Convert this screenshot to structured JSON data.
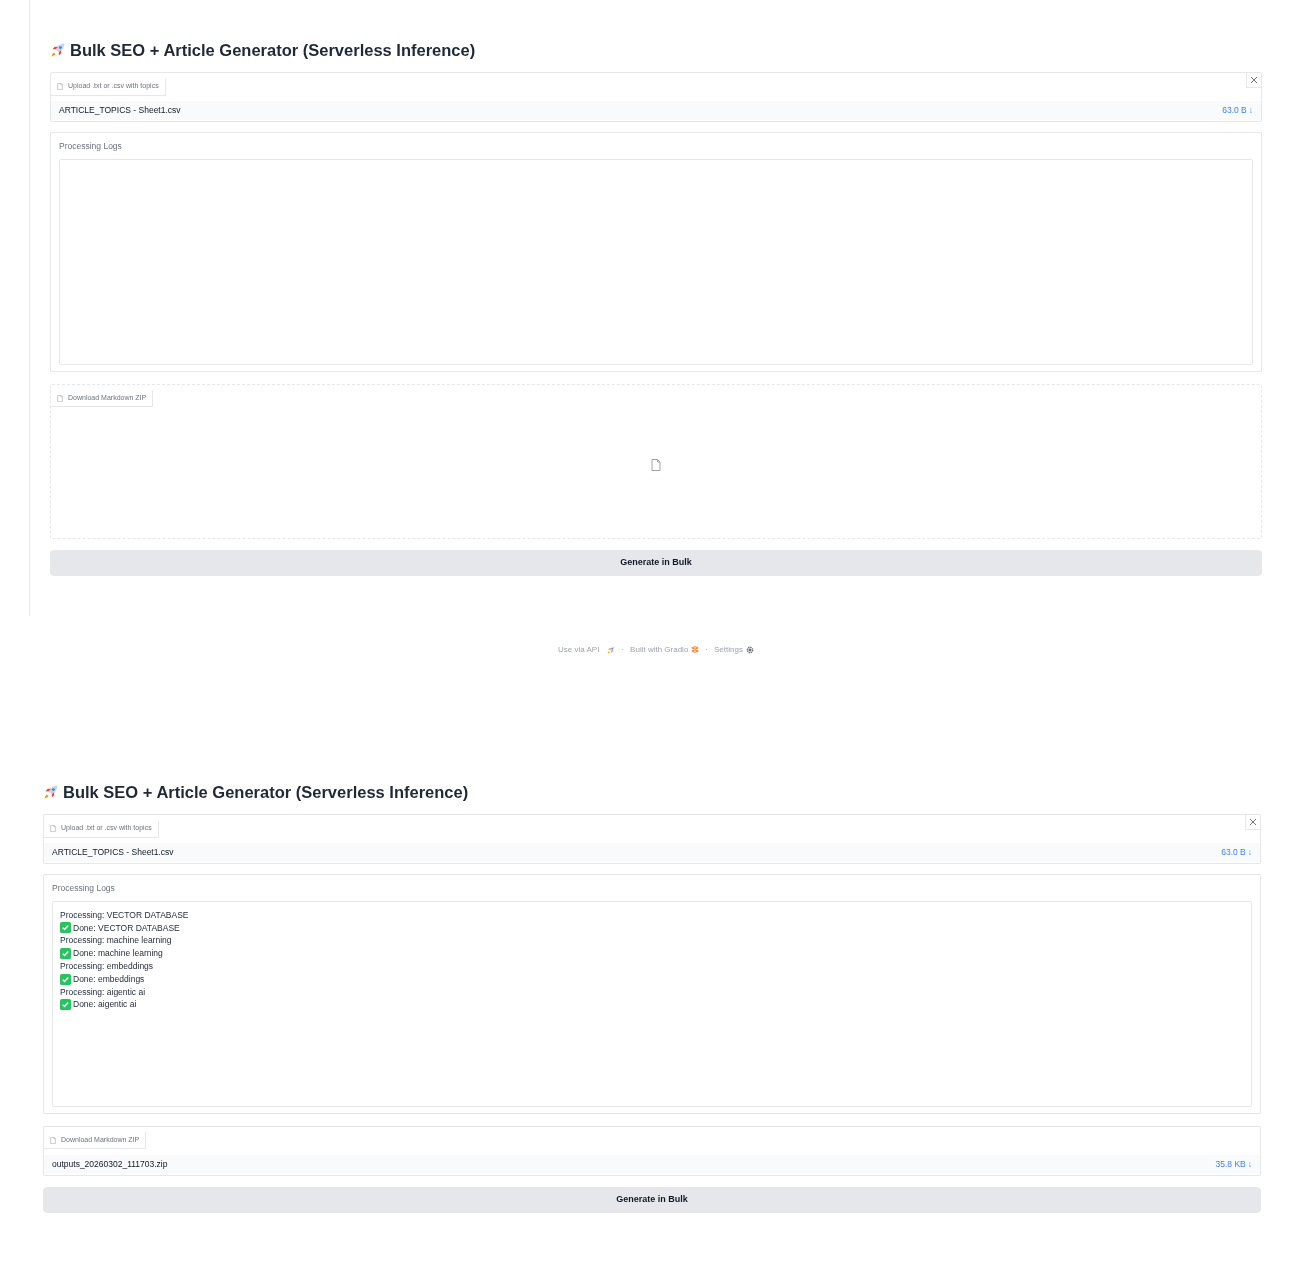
{
  "screens": [
    {
      "title": "Bulk SEO + Article Generator (Serverless Inference)",
      "upload": {
        "label": "Upload .txt or .csv with topics",
        "file": {
          "name": "ARTICLE_TOPICS - Sheet1.csv",
          "size": "63.0 B",
          "glyph": "↓"
        }
      },
      "logs": {
        "label": "Processing Logs"
      },
      "download": {
        "label": "Download Markdown ZIP"
      },
      "button": "Generate in Bulk",
      "footer": [
        {
          "kind": "api",
          "text": "Use via API"
        },
        {
          "kind": "sep",
          "text": "·"
        },
        {
          "kind": "gradio",
          "text": "Built with Gradio"
        },
        {
          "kind": "sep",
          "text": "·"
        },
        {
          "kind": "settings",
          "text": "Settings"
        }
      ]
    },
    {
      "title": "Bulk SEO + Article Generator (Serverless Inference)",
      "upload": {
        "label": "Upload .txt or .csv with topics",
        "file": {
          "name": "ARTICLE_TOPICS - Sheet1.csv",
          "size": "63.0 B",
          "glyph": "↓"
        }
      },
      "logs": {
        "label": "Processing Logs",
        "lines": [
          {
            "kind": "processing",
            "text": "Processing: VECTOR DATABASE"
          },
          {
            "kind": "done",
            "text": "Done: VECTOR DATABASE"
          },
          {
            "kind": "processing",
            "text": "Processing: machine learning"
          },
          {
            "kind": "done",
            "text": "Done: machine learning"
          },
          {
            "kind": "processing",
            "text": "Processing: embeddings"
          },
          {
            "kind": "done",
            "text": "Done: embeddings"
          },
          {
            "kind": "processing",
            "text": "Processing: aigentic ai"
          },
          {
            "kind": "done",
            "text": "Done: aigentic ai"
          }
        ]
      },
      "download": {
        "label": "Download Markdown ZIP",
        "file": {
          "name": "outputs_20260302_111703.zip",
          "size": "35.8 KB",
          "glyph": "↓"
        }
      },
      "button": "Generate in Bulk"
    }
  ]
}
